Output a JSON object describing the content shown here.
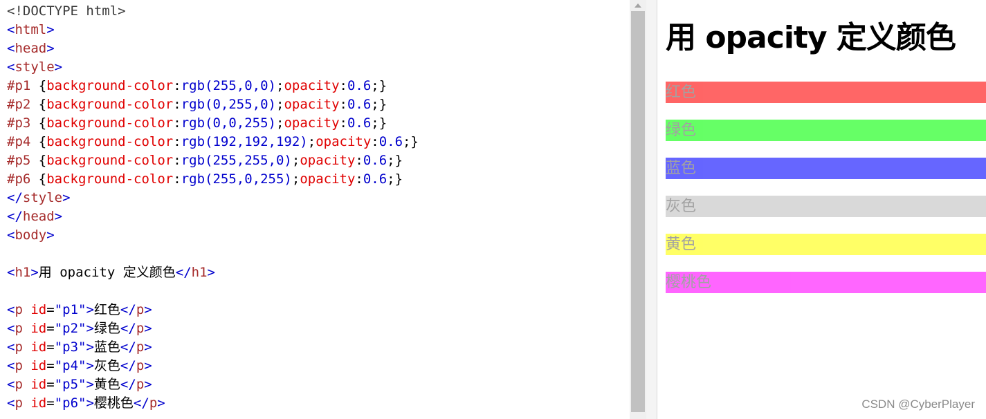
{
  "editor": {
    "lines": [
      [
        {
          "c": "t-doc",
          "t": "<!DOCTYPE html>"
        }
      ],
      [
        {
          "c": "t-br",
          "t": "<"
        },
        {
          "c": "t-tag",
          "t": "html"
        },
        {
          "c": "t-br",
          "t": ">"
        }
      ],
      [
        {
          "c": "t-br",
          "t": "<"
        },
        {
          "c": "t-tag",
          "t": "head"
        },
        {
          "c": "t-br",
          "t": ">"
        }
      ],
      [
        {
          "c": "t-br",
          "t": "<"
        },
        {
          "c": "t-tag",
          "t": "style"
        },
        {
          "c": "t-br",
          "t": ">"
        }
      ],
      [
        {
          "c": "t-sel",
          "t": "#p1 "
        },
        {
          "c": "t-punc",
          "t": "{"
        },
        {
          "c": "t-prop",
          "t": "background-color"
        },
        {
          "c": "t-punc",
          "t": ":"
        },
        {
          "c": "t-val",
          "t": "rgb(255,0,0)"
        },
        {
          "c": "t-punc",
          "t": ";"
        },
        {
          "c": "t-prop",
          "t": "opacity"
        },
        {
          "c": "t-punc",
          "t": ":"
        },
        {
          "c": "t-val",
          "t": "0.6"
        },
        {
          "c": "t-punc",
          "t": ";}"
        }
      ],
      [
        {
          "c": "t-sel",
          "t": "#p2 "
        },
        {
          "c": "t-punc",
          "t": "{"
        },
        {
          "c": "t-prop",
          "t": "background-color"
        },
        {
          "c": "t-punc",
          "t": ":"
        },
        {
          "c": "t-val",
          "t": "rgb(0,255,0)"
        },
        {
          "c": "t-punc",
          "t": ";"
        },
        {
          "c": "t-prop",
          "t": "opacity"
        },
        {
          "c": "t-punc",
          "t": ":"
        },
        {
          "c": "t-val",
          "t": "0.6"
        },
        {
          "c": "t-punc",
          "t": ";}"
        }
      ],
      [
        {
          "c": "t-sel",
          "t": "#p3 "
        },
        {
          "c": "t-punc",
          "t": "{"
        },
        {
          "c": "t-prop",
          "t": "background-color"
        },
        {
          "c": "t-punc",
          "t": ":"
        },
        {
          "c": "t-val",
          "t": "rgb(0,0,255)"
        },
        {
          "c": "t-punc",
          "t": ";"
        },
        {
          "c": "t-prop",
          "t": "opacity"
        },
        {
          "c": "t-punc",
          "t": ":"
        },
        {
          "c": "t-val",
          "t": "0.6"
        },
        {
          "c": "t-punc",
          "t": ";}"
        }
      ],
      [
        {
          "c": "t-sel",
          "t": "#p4 "
        },
        {
          "c": "t-punc",
          "t": "{"
        },
        {
          "c": "t-prop",
          "t": "background-color"
        },
        {
          "c": "t-punc",
          "t": ":"
        },
        {
          "c": "t-val",
          "t": "rgb(192,192,192)"
        },
        {
          "c": "t-punc",
          "t": ";"
        },
        {
          "c": "t-prop",
          "t": "opacity"
        },
        {
          "c": "t-punc",
          "t": ":"
        },
        {
          "c": "t-val",
          "t": "0.6"
        },
        {
          "c": "t-punc",
          "t": ";}"
        }
      ],
      [
        {
          "c": "t-sel",
          "t": "#p5 "
        },
        {
          "c": "t-punc",
          "t": "{"
        },
        {
          "c": "t-prop",
          "t": "background-color"
        },
        {
          "c": "t-punc",
          "t": ":"
        },
        {
          "c": "t-val",
          "t": "rgb(255,255,0)"
        },
        {
          "c": "t-punc",
          "t": ";"
        },
        {
          "c": "t-prop",
          "t": "opacity"
        },
        {
          "c": "t-punc",
          "t": ":"
        },
        {
          "c": "t-val",
          "t": "0.6"
        },
        {
          "c": "t-punc",
          "t": ";}"
        }
      ],
      [
        {
          "c": "t-sel",
          "t": "#p6 "
        },
        {
          "c": "t-punc",
          "t": "{"
        },
        {
          "c": "t-prop",
          "t": "background-color"
        },
        {
          "c": "t-punc",
          "t": ":"
        },
        {
          "c": "t-val",
          "t": "rgb(255,0,255)"
        },
        {
          "c": "t-punc",
          "t": ";"
        },
        {
          "c": "t-prop",
          "t": "opacity"
        },
        {
          "c": "t-punc",
          "t": ":"
        },
        {
          "c": "t-val",
          "t": "0.6"
        },
        {
          "c": "t-punc",
          "t": ";}"
        }
      ],
      [
        {
          "c": "t-br",
          "t": "</"
        },
        {
          "c": "t-tag",
          "t": "style"
        },
        {
          "c": "t-br",
          "t": ">"
        }
      ],
      [
        {
          "c": "t-br",
          "t": "</"
        },
        {
          "c": "t-tag",
          "t": "head"
        },
        {
          "c": "t-br",
          "t": ">"
        }
      ],
      [
        {
          "c": "t-br",
          "t": "<"
        },
        {
          "c": "t-tag",
          "t": "body"
        },
        {
          "c": "t-br",
          "t": ">"
        }
      ],
      [],
      [
        {
          "c": "t-br",
          "t": "<"
        },
        {
          "c": "t-tag",
          "t": "h1"
        },
        {
          "c": "t-br",
          "t": ">"
        },
        {
          "c": "t-txt",
          "t": "用 opacity 定义颜色"
        },
        {
          "c": "t-br",
          "t": "</"
        },
        {
          "c": "t-tag",
          "t": "h1"
        },
        {
          "c": "t-br",
          "t": ">"
        }
      ],
      [],
      [
        {
          "c": "t-br",
          "t": "<"
        },
        {
          "c": "t-tag",
          "t": "p "
        },
        {
          "c": "t-attr",
          "t": "id"
        },
        {
          "c": "t-punc",
          "t": "="
        },
        {
          "c": "t-str",
          "t": "\"p1\""
        },
        {
          "c": "t-br",
          "t": ">"
        },
        {
          "c": "t-txt",
          "t": "红色"
        },
        {
          "c": "t-br",
          "t": "</"
        },
        {
          "c": "t-tag",
          "t": "p"
        },
        {
          "c": "t-br",
          "t": ">"
        }
      ],
      [
        {
          "c": "t-br",
          "t": "<"
        },
        {
          "c": "t-tag",
          "t": "p "
        },
        {
          "c": "t-attr",
          "t": "id"
        },
        {
          "c": "t-punc",
          "t": "="
        },
        {
          "c": "t-str",
          "t": "\"p2\""
        },
        {
          "c": "t-br",
          "t": ">"
        },
        {
          "c": "t-txt",
          "t": "绿色"
        },
        {
          "c": "t-br",
          "t": "</"
        },
        {
          "c": "t-tag",
          "t": "p"
        },
        {
          "c": "t-br",
          "t": ">"
        }
      ],
      [
        {
          "c": "t-br",
          "t": "<"
        },
        {
          "c": "t-tag",
          "t": "p "
        },
        {
          "c": "t-attr",
          "t": "id"
        },
        {
          "c": "t-punc",
          "t": "="
        },
        {
          "c": "t-str",
          "t": "\"p3\""
        },
        {
          "c": "t-br",
          "t": ">"
        },
        {
          "c": "t-txt",
          "t": "蓝色"
        },
        {
          "c": "t-br",
          "t": "</"
        },
        {
          "c": "t-tag",
          "t": "p"
        },
        {
          "c": "t-br",
          "t": ">"
        }
      ],
      [
        {
          "c": "t-br",
          "t": "<"
        },
        {
          "c": "t-tag",
          "t": "p "
        },
        {
          "c": "t-attr",
          "t": "id"
        },
        {
          "c": "t-punc",
          "t": "="
        },
        {
          "c": "t-str",
          "t": "\"p4\""
        },
        {
          "c": "t-br",
          "t": ">"
        },
        {
          "c": "t-txt",
          "t": "灰色"
        },
        {
          "c": "t-br",
          "t": "</"
        },
        {
          "c": "t-tag",
          "t": "p"
        },
        {
          "c": "t-br",
          "t": ">"
        }
      ],
      [
        {
          "c": "t-br",
          "t": "<"
        },
        {
          "c": "t-tag",
          "t": "p "
        },
        {
          "c": "t-attr",
          "t": "id"
        },
        {
          "c": "t-punc",
          "t": "="
        },
        {
          "c": "t-str",
          "t": "\"p5\""
        },
        {
          "c": "t-br",
          "t": ">"
        },
        {
          "c": "t-txt",
          "t": "黄色"
        },
        {
          "c": "t-br",
          "t": "</"
        },
        {
          "c": "t-tag",
          "t": "p"
        },
        {
          "c": "t-br",
          "t": ">"
        }
      ],
      [
        {
          "c": "t-br",
          "t": "<"
        },
        {
          "c": "t-tag",
          "t": "p "
        },
        {
          "c": "t-attr",
          "t": "id"
        },
        {
          "c": "t-punc",
          "t": "="
        },
        {
          "c": "t-str",
          "t": "\"p6\""
        },
        {
          "c": "t-br",
          "t": ">"
        },
        {
          "c": "t-txt",
          "t": "樱桃色"
        },
        {
          "c": "t-br",
          "t": "</"
        },
        {
          "c": "t-tag",
          "t": "p"
        },
        {
          "c": "t-br",
          "t": ">"
        }
      ]
    ]
  },
  "result": {
    "heading": "用 opacity 定义颜色",
    "paragraphs": [
      {
        "id": "p1",
        "text": "红色",
        "rgb": "rgb(255,0,0)",
        "opacity": 0.6
      },
      {
        "id": "p2",
        "text": "绿色",
        "rgb": "rgb(0,255,0)",
        "opacity": 0.6
      },
      {
        "id": "p3",
        "text": "蓝色",
        "rgb": "rgb(0,0,255)",
        "opacity": 0.6
      },
      {
        "id": "p4",
        "text": "灰色",
        "rgb": "rgb(192,192,192)",
        "opacity": 0.6
      },
      {
        "id": "p5",
        "text": "黄色",
        "rgb": "rgb(255,255,0)",
        "opacity": 0.6
      },
      {
        "id": "p6",
        "text": "樱桃色",
        "rgb": "rgb(255,0,255)",
        "opacity": 0.6
      }
    ]
  },
  "watermark": "CSDN @CyberPlayer"
}
